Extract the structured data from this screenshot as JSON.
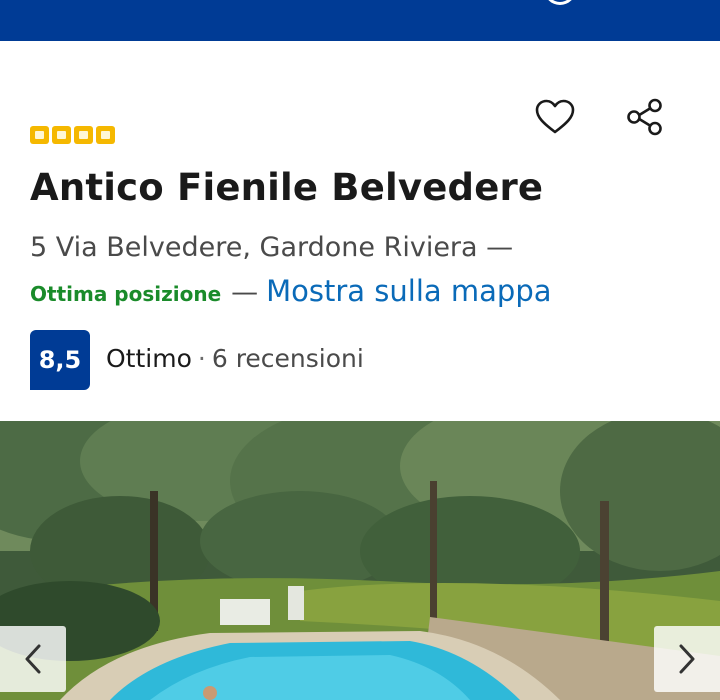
{
  "hotel": {
    "stars": 4,
    "name": "Antico Fienile Belvedere",
    "address": "5 Via Belvedere, Gardone Riviera —",
    "location_label": "Ottima posizione",
    "location_separator": "—",
    "map_link": "Mostra sulla mappa"
  },
  "rating": {
    "score": "8,5",
    "word": "Ottimo",
    "separator": "·",
    "reviews": "6 recensioni"
  },
  "actions": {
    "favorite_icon": "heart-outline",
    "share_icon": "share-nodes"
  },
  "gallery": {
    "prev_icon": "chevron-left",
    "next_icon": "chevron-right"
  },
  "colors": {
    "brand_blue": "#003b95",
    "link_blue": "#0a6ab8",
    "location_green": "#1a8b2a",
    "star_yellow": "#f5b800"
  }
}
